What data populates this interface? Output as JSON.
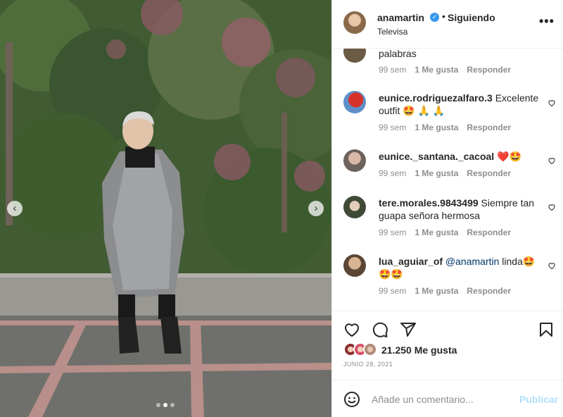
{
  "header": {
    "username": "anamartin",
    "separator": "•",
    "follow_state": "Siguiendo",
    "subtitle": "Televisa",
    "more": "•••",
    "verified_icon": "verified-badge-icon"
  },
  "comments": [
    {
      "user": "",
      "text": "palabras",
      "time": "99 sem",
      "likes": "1 Me gusta",
      "reply": "Responder",
      "avatar_color": "#6b5a44"
    },
    {
      "user": "eunice.rodriguezalfaro.3",
      "text": " Excelente outfit 🤩 🙏 🙏",
      "time": "99 sem",
      "likes": "1 Me gusta",
      "reply": "Responder",
      "avatar_color": "#c9302c"
    },
    {
      "user": "eunice._santana._cacoal",
      "text": " ❤️🤩",
      "time": "99 sem",
      "likes": "1 Me gusta",
      "reply": "Responder",
      "avatar_color": "#7a6d68"
    },
    {
      "user": "tere.morales.9843499",
      "text": " Siempre tan guapa señora hermosa",
      "time": "99 sem",
      "likes": "1 Me gusta",
      "reply": "Responder",
      "avatar_color": "#3e4a36"
    },
    {
      "user": "lua_aguiar_of",
      "mention": "@anamartin",
      "text": " linda🤩🤩🤩",
      "time": "99 sem",
      "likes": "1 Me gusta",
      "reply": "Responder",
      "avatar_color": "#5b4636"
    }
  ],
  "actions": {
    "like_icon": "heart-icon",
    "comment_icon": "comment-icon",
    "share_icon": "share-icon",
    "save_icon": "bookmark-icon"
  },
  "likes": {
    "count_text": "21.250 Me gusta",
    "avatar_colors": [
      "#8b2d2d",
      "#d94f6b",
      "#b08a7a"
    ]
  },
  "date": "JUNIO 28, 2021",
  "composer": {
    "placeholder": "Añade un comentario...",
    "post_label": "Publicar",
    "emoji_icon": "emoji-icon"
  },
  "carousel": {
    "prev_glyph": "‹",
    "next_glyph": "›",
    "dots": 3,
    "active_index": 1
  }
}
